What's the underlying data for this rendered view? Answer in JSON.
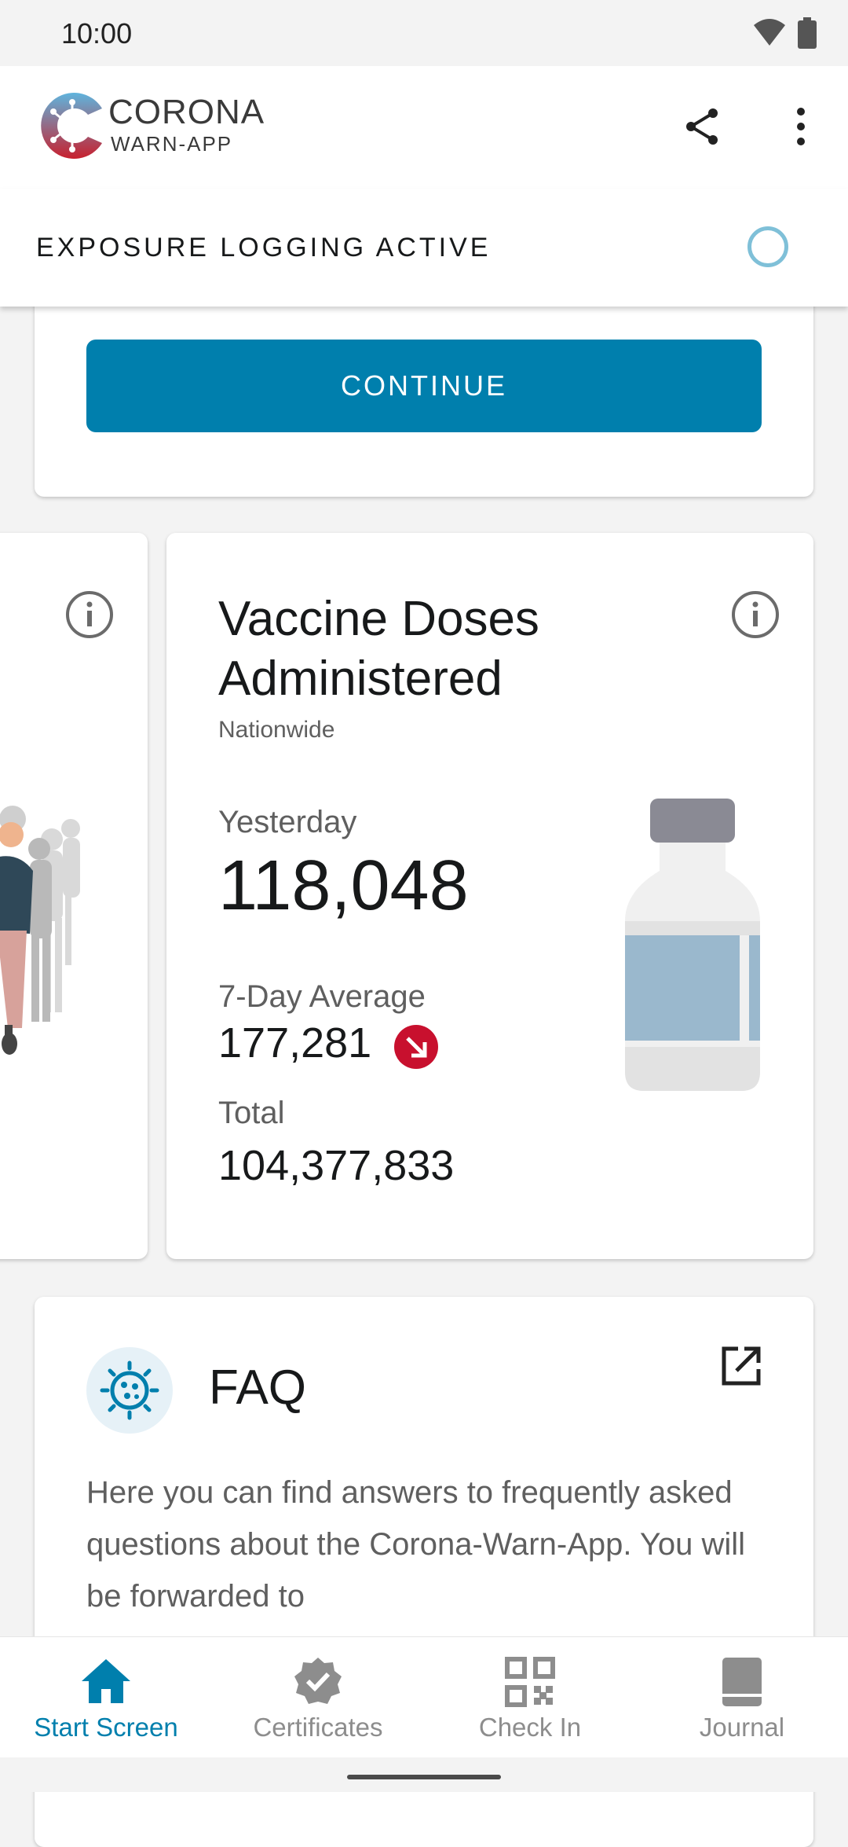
{
  "status_bar": {
    "time": "10:00",
    "icons": [
      "wifi-icon",
      "battery-icon"
    ]
  },
  "app_bar": {
    "brand_line1": "CORONA",
    "brand_line2": "WARN-APP",
    "actions": [
      "share-icon",
      "more-vert-icon"
    ]
  },
  "exposure_banner": {
    "label": "EXPOSURE LOGGING ACTIVE",
    "indicator": "ring-icon"
  },
  "continue_card": {
    "button_label": "CONTINUE"
  },
  "vaccine_card": {
    "title_line1": "Vaccine Doses",
    "title_line2": "Administered",
    "subtitle": "Nationwide",
    "yesterday_label": "Yesterday",
    "yesterday_value": "118,048",
    "average_label": "7-Day Average",
    "average_value": "177,281",
    "trend_icon": "arrow-down-right-icon",
    "total_label": "Total",
    "total_value": "104,377,833"
  },
  "faq_card": {
    "title": "FAQ",
    "body": "Here you can find answers to frequently asked questions about the Corona-Warn-App. You will be forwarded to"
  },
  "bottom_nav": {
    "items": [
      {
        "label": "Start Screen",
        "icon": "home-icon",
        "active": true
      },
      {
        "label": "Certificates",
        "icon": "certificate-icon",
        "active": false
      },
      {
        "label": "Check In",
        "icon": "qr-code-icon",
        "active": false
      },
      {
        "label": "Journal",
        "icon": "journal-icon",
        "active": false
      }
    ]
  },
  "colors": {
    "accent": "#007fad",
    "trend_down": "#c8102e",
    "indicator_ring": "#7fc0d8",
    "vial_label": "#9ab8cd"
  }
}
